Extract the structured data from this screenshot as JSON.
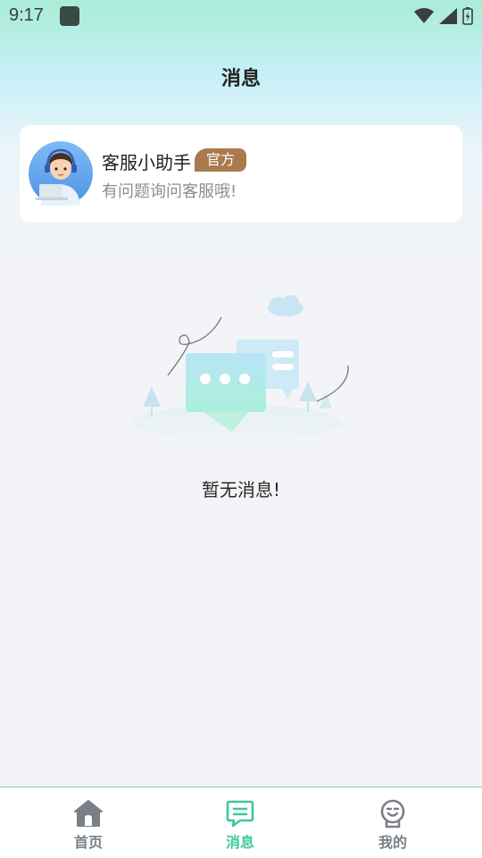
{
  "status_bar": {
    "time": "9:17"
  },
  "header": {
    "title": "消息"
  },
  "service_card": {
    "name": "客服小助手",
    "badge": "官方",
    "description": "有问题询问客服哦!"
  },
  "empty_state": {
    "text": "暂无消息!"
  },
  "bottom_nav": {
    "items": [
      {
        "label": "首页",
        "icon": "home-icon",
        "active": false
      },
      {
        "label": "消息",
        "icon": "message-icon",
        "active": true
      },
      {
        "label": "我的",
        "icon": "profile-icon",
        "active": false
      }
    ]
  },
  "colors": {
    "accent": "#3cc9a0",
    "inactive": "#7a7f88",
    "badge": "#a97a4e"
  }
}
